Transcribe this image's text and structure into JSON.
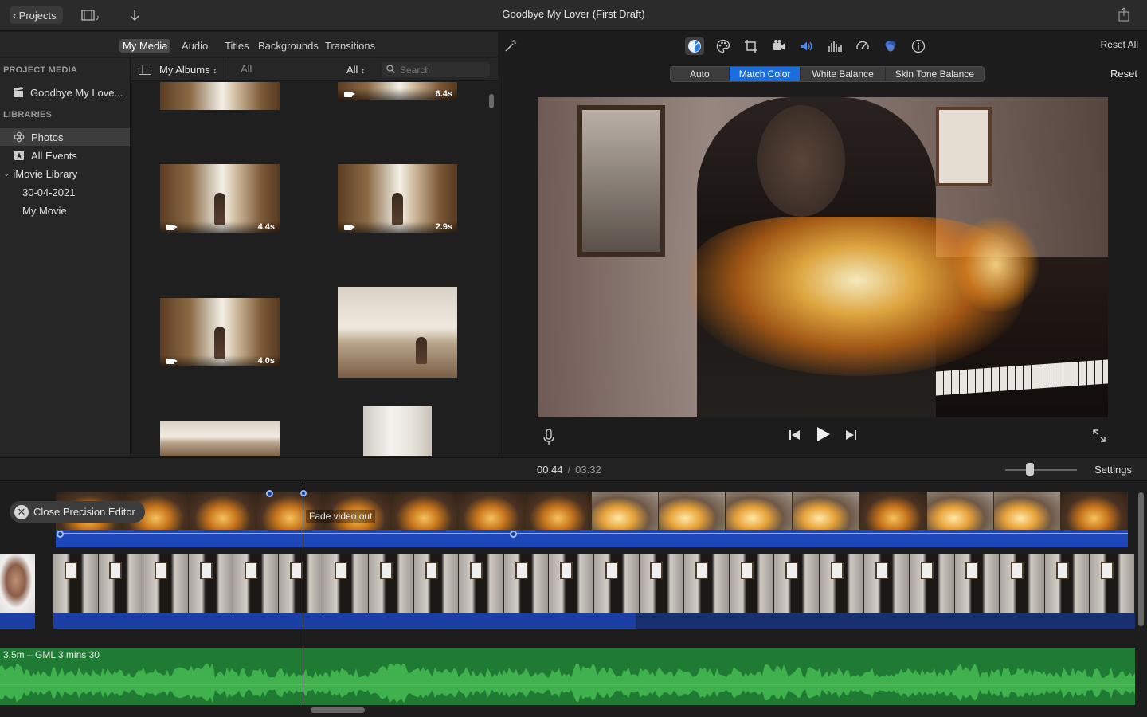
{
  "titlebar": {
    "projects_label": "Projects",
    "title": "Goodbye My Lover (First Draft)"
  },
  "media_tabs": [
    "My Media",
    "Audio",
    "Titles",
    "Backgrounds",
    "Transitions"
  ],
  "sidebar": {
    "project_media_heading": "PROJECT MEDIA",
    "project_item": "Goodbye My Love...",
    "libraries_heading": "LIBRARIES",
    "items": [
      {
        "label": "Photos",
        "selected": true
      },
      {
        "label": "All Events"
      },
      {
        "label": "iMovie Library"
      },
      {
        "label": "30-04-2021"
      },
      {
        "label": "My Movie"
      }
    ]
  },
  "browser": {
    "albums_label": "My Albums",
    "breadcrumb": "All",
    "filter_label": "All",
    "search_placeholder": "Search",
    "clips": [
      {
        "duration": "6.4s"
      },
      {
        "duration": "4.4s"
      },
      {
        "duration": "2.9s"
      },
      {
        "duration": "4.0s"
      }
    ]
  },
  "adjustments": {
    "reset_all": "Reset All",
    "segments": [
      "Auto",
      "Match Color",
      "White Balance",
      "Skin Tone Balance"
    ],
    "active_segment": "Match Color",
    "reset": "Reset"
  },
  "timeline": {
    "current_time": "00:44",
    "total_time": "03:32",
    "settings": "Settings",
    "close_precision_editor": "Close Precision Editor",
    "fade_label": "Fade video out",
    "music_label": "3.5m – GML 3 mins 30"
  },
  "colors": {
    "accent": "#1a6fe0",
    "audio_track": "#1b3fa5",
    "music_track": "#1f7a33"
  }
}
